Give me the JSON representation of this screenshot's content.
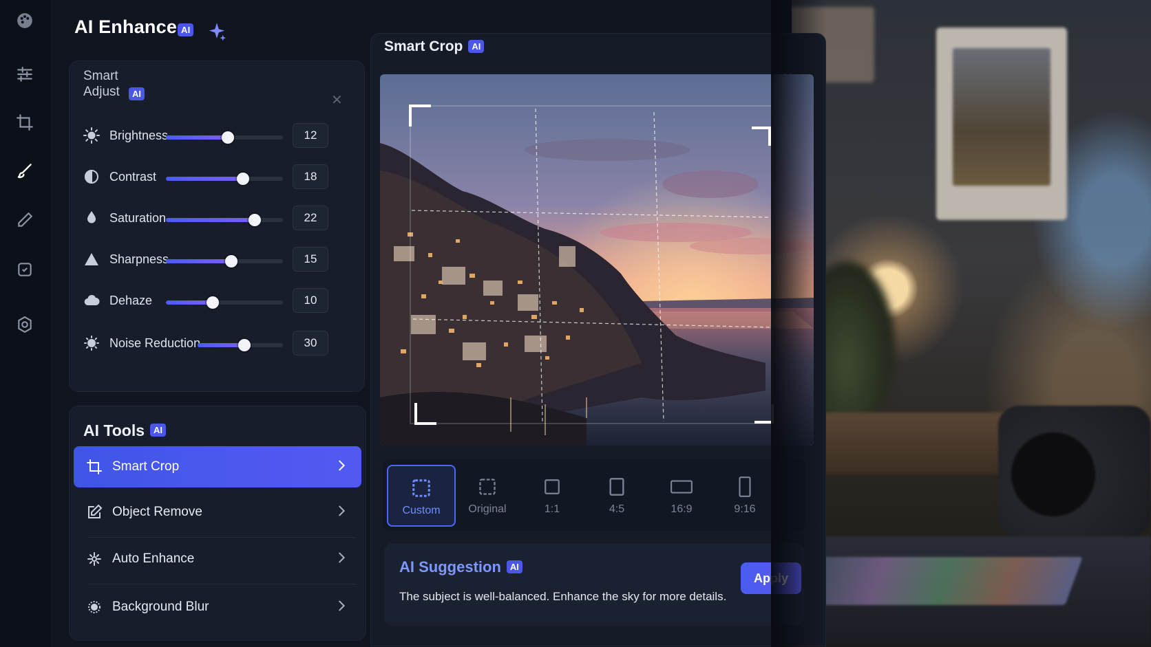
{
  "app": {
    "title": "AI Enhance",
    "badge": "AI"
  },
  "rail": {
    "icons": [
      "palette-icon",
      "sliders-icon",
      "crop-icon",
      "brush-icon",
      "pen-icon",
      "ai-chip-icon",
      "settings-icon"
    ],
    "active": "brush-icon"
  },
  "smart_adjust": {
    "title_line1": "Smart",
    "title_line2": "Adjust",
    "badge": "AI",
    "sliders": [
      {
        "label": "Brightness",
        "value": "12",
        "level": 0.53,
        "icon": "sun-icon"
      },
      {
        "label": "Contrast",
        "value": "18",
        "level": 0.66,
        "icon": "contrast-icon"
      },
      {
        "label": "Saturation",
        "value": "22",
        "level": 0.76,
        "icon": "droplet-icon"
      },
      {
        "label": "Sharpness",
        "value": "15",
        "level": 0.56,
        "icon": "triangle-icon"
      },
      {
        "label": "Dehaze",
        "value": "10",
        "level": 0.4,
        "icon": "cloud-icon"
      },
      {
        "label": "Noise Reduction",
        "value": "30",
        "level": 0.55,
        "icon": "noise-icon"
      }
    ]
  },
  "ai_tools": {
    "title": "AI Tools",
    "badge": "AI",
    "items": [
      {
        "label": "Smart Crop",
        "icon": "crop-icon",
        "active": true
      },
      {
        "label": "Object Remove",
        "icon": "edit-box-icon",
        "active": false
      },
      {
        "label": "Auto Enhance",
        "icon": "sparkle-icon",
        "active": false
      },
      {
        "label": "Background Blur",
        "icon": "blur-icon",
        "active": false
      }
    ]
  },
  "smart_crop": {
    "title": "Smart Crop",
    "badge": "AI",
    "ratios": [
      {
        "label": "Custom",
        "active": true
      },
      {
        "label": "Original",
        "active": false
      },
      {
        "label": "1:1",
        "active": false
      },
      {
        "label": "4:5",
        "active": false
      },
      {
        "label": "16:9",
        "active": false
      },
      {
        "label": "9:16",
        "active": false
      }
    ]
  },
  "suggestion": {
    "title": "AI Suggestion",
    "badge": "AI",
    "text": "The subject is well-balanced. Enhance the sky for more details.",
    "apply_label": "Apply"
  },
  "colors": {
    "accent": "#4b5cf0",
    "panel": "#171d2a",
    "background": "#101520"
  }
}
